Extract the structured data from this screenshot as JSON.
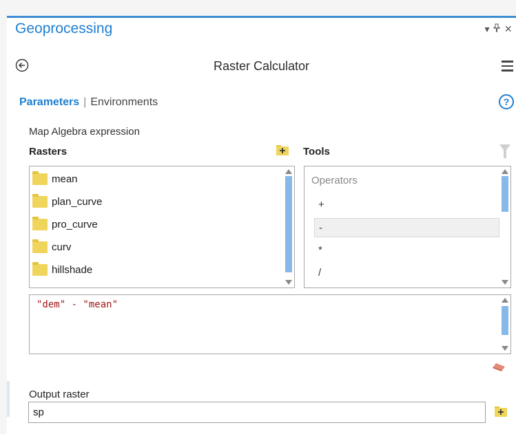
{
  "pane": {
    "title": "Geoprocessing",
    "controls": {
      "dropdown": "▾",
      "pin": "ᵖ",
      "close": "×"
    }
  },
  "tool": {
    "title": "Raster Calculator"
  },
  "tabs": {
    "parameters": "Parameters",
    "separator": "|",
    "environments": "Environments"
  },
  "help": "?",
  "expression_section": {
    "label": "Map Algebra expression",
    "rasters_header": "Rasters",
    "tools_header": "Tools",
    "rasters": [
      "mean",
      "plan_curve",
      "pro_curve",
      "curv",
      "hillshade"
    ],
    "operators_label": "Operators",
    "operators": [
      "+",
      "-",
      "*",
      "/"
    ],
    "selected_operator_index": 1,
    "expression": "\"dem\" - \"mean\""
  },
  "output": {
    "label": "Output raster",
    "value": "sp"
  },
  "colors": {
    "accent": "#1d7fd1",
    "scroll_thumb": "#85b9e8",
    "folder": "#f0d55c"
  },
  "icons": [
    "back-arrow-icon",
    "hamburger-menu-icon",
    "help-icon",
    "filter-icon",
    "add-raster-icon",
    "folder-icon",
    "eraser-icon"
  ]
}
